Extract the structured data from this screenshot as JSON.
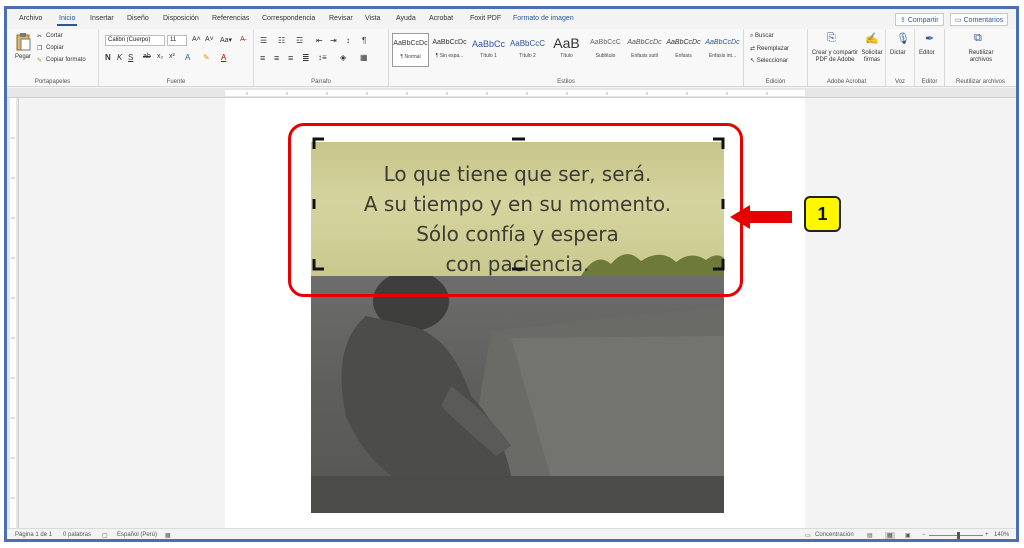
{
  "tabs": [
    "Archivo",
    "Inicio",
    "Insertar",
    "Diseño",
    "Disposición",
    "Referencias",
    "Correspondencia",
    "Revisar",
    "Vista",
    "Ayuda",
    "Acrobat",
    "Foxit PDF",
    "Formato de imagen"
  ],
  "active_tab": "Inicio",
  "top_buttons": {
    "share": "Compartir",
    "comments": "Comentarios"
  },
  "clipboard": {
    "paste": "Pegar",
    "cut": "Cortar",
    "copy": "Copiar",
    "format_painter": "Copiar formato",
    "group_label": "Portapapeles"
  },
  "font": {
    "name": "Calibri (Cuerpo)",
    "size": "11",
    "group_label": "Fuente"
  },
  "paragraph": {
    "group_label": "Párrafo"
  },
  "styles": {
    "group_label": "Estilos",
    "items": [
      {
        "preview": "AaBbCcDc",
        "name": "¶ Normal"
      },
      {
        "preview": "AaBbCcDc",
        "name": "¶ Sin espa..."
      },
      {
        "preview": "AaBbCc",
        "name": "Título 1"
      },
      {
        "preview": "AaBbCcC",
        "name": "Título 2"
      },
      {
        "preview": "AaB",
        "name": "Título"
      },
      {
        "preview": "AaBbCcC",
        "name": "Subtítulo"
      },
      {
        "preview": "AaBbCcDc",
        "name": "Énfasis sutil"
      },
      {
        "preview": "AaBbCcDc",
        "name": "Énfasis"
      },
      {
        "preview": "AaBbCcDc",
        "name": "Énfasis int..."
      }
    ]
  },
  "editing": {
    "find": "Buscar",
    "replace": "Reemplazar",
    "select": "Seleccionar",
    "group_label": "Edición"
  },
  "adobe": {
    "create_pdf": "Crear y compartir PDF de Adobe",
    "request_sign": "Solicitar firmas",
    "group_label": "Adobe Acrobat"
  },
  "voice": {
    "dictate": "Dictar",
    "group_label": "Voz"
  },
  "editor": {
    "label": "Editor",
    "group_label": "Editor"
  },
  "reuse": {
    "label": "Reutilizar archivos",
    "group_label": "Reutilizar archivos"
  },
  "image_quote": [
    "Lo que tiene que ser, será.",
    "A su tiempo y en su momento.",
    "Sólo confía y espera",
    "con paciencia."
  ],
  "callout_number": "1",
  "status": {
    "page": "Página 1 de 1",
    "words": "0 palabras",
    "language": "Español (Perú)",
    "focus": "Concentración",
    "zoom": "140%"
  },
  "colors": {
    "accent": "#2b579a",
    "callout": "#e60000",
    "badge": "#fff700"
  }
}
